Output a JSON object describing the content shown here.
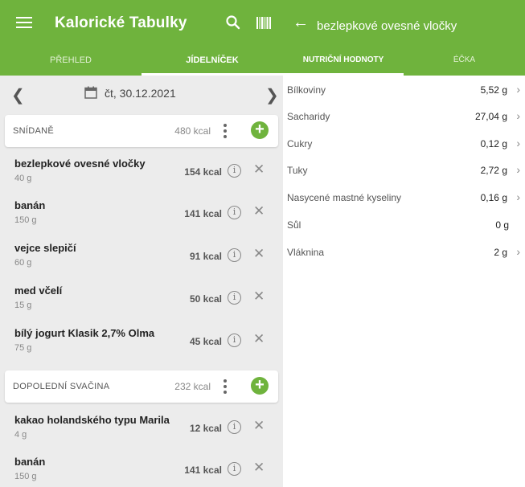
{
  "colors": {
    "brand_green": "#6fb33d",
    "panel_gray": "#ececec"
  },
  "left": {
    "app_title": "Kalorické Tabulky",
    "icons": {
      "menu": "hamburger-menu-icon",
      "search": "search-icon",
      "barcode": "barcode-icon"
    },
    "tabs": [
      {
        "label": "PŘEHLED",
        "active": false
      },
      {
        "label": "JÍDELNÍČEK",
        "active": true
      }
    ],
    "date": "čt, 30.12.2021",
    "meals": [
      {
        "name": "SNÍDANĚ",
        "kcal": "480 kcal",
        "items": [
          {
            "name": "bezlepkové ovesné vločky",
            "weight": "40 g",
            "kcal": "154 kcal"
          },
          {
            "name": "banán",
            "weight": "150 g",
            "kcal": "141 kcal"
          },
          {
            "name": "vejce slepičí",
            "weight": "60 g",
            "kcal": "91 kcal"
          },
          {
            "name": "med včelí",
            "weight": "15 g",
            "kcal": "50 kcal"
          },
          {
            "name": "bílý jogurt Klasik 2,7% Olma",
            "weight": "75 g",
            "kcal": "45 kcal"
          }
        ]
      },
      {
        "name": "DOPOLEDNÍ SVAČINA",
        "kcal": "232 kcal",
        "items": [
          {
            "name": "kakao holandského typu Marila",
            "weight": "4 g",
            "kcal": "12 kcal"
          },
          {
            "name": "banán",
            "weight": "150 g",
            "kcal": "141 kcal"
          }
        ]
      }
    ]
  },
  "right": {
    "title": "bezlepkové ovesné vločky",
    "tabs": [
      {
        "label": "NUTRIČNÍ HODNOTY",
        "active": true
      },
      {
        "label": "ÉČKA",
        "active": false
      }
    ],
    "rows": [
      {
        "label": "Bílkoviny",
        "value": "5,52 g",
        "chevron": true
      },
      {
        "label": "Sacharidy",
        "value": "27,04 g",
        "chevron": true
      },
      {
        "label": "Cukry",
        "value": "0,12 g",
        "chevron": true
      },
      {
        "label": "Tuky",
        "value": "2,72 g",
        "chevron": true
      },
      {
        "label": "Nasycené mastné kyseliny",
        "value": "0,16 g",
        "chevron": true
      },
      {
        "label": "Sůl",
        "value": "0 g",
        "chevron": false
      },
      {
        "label": "Vláknina",
        "value": "2 g",
        "chevron": true
      }
    ]
  }
}
